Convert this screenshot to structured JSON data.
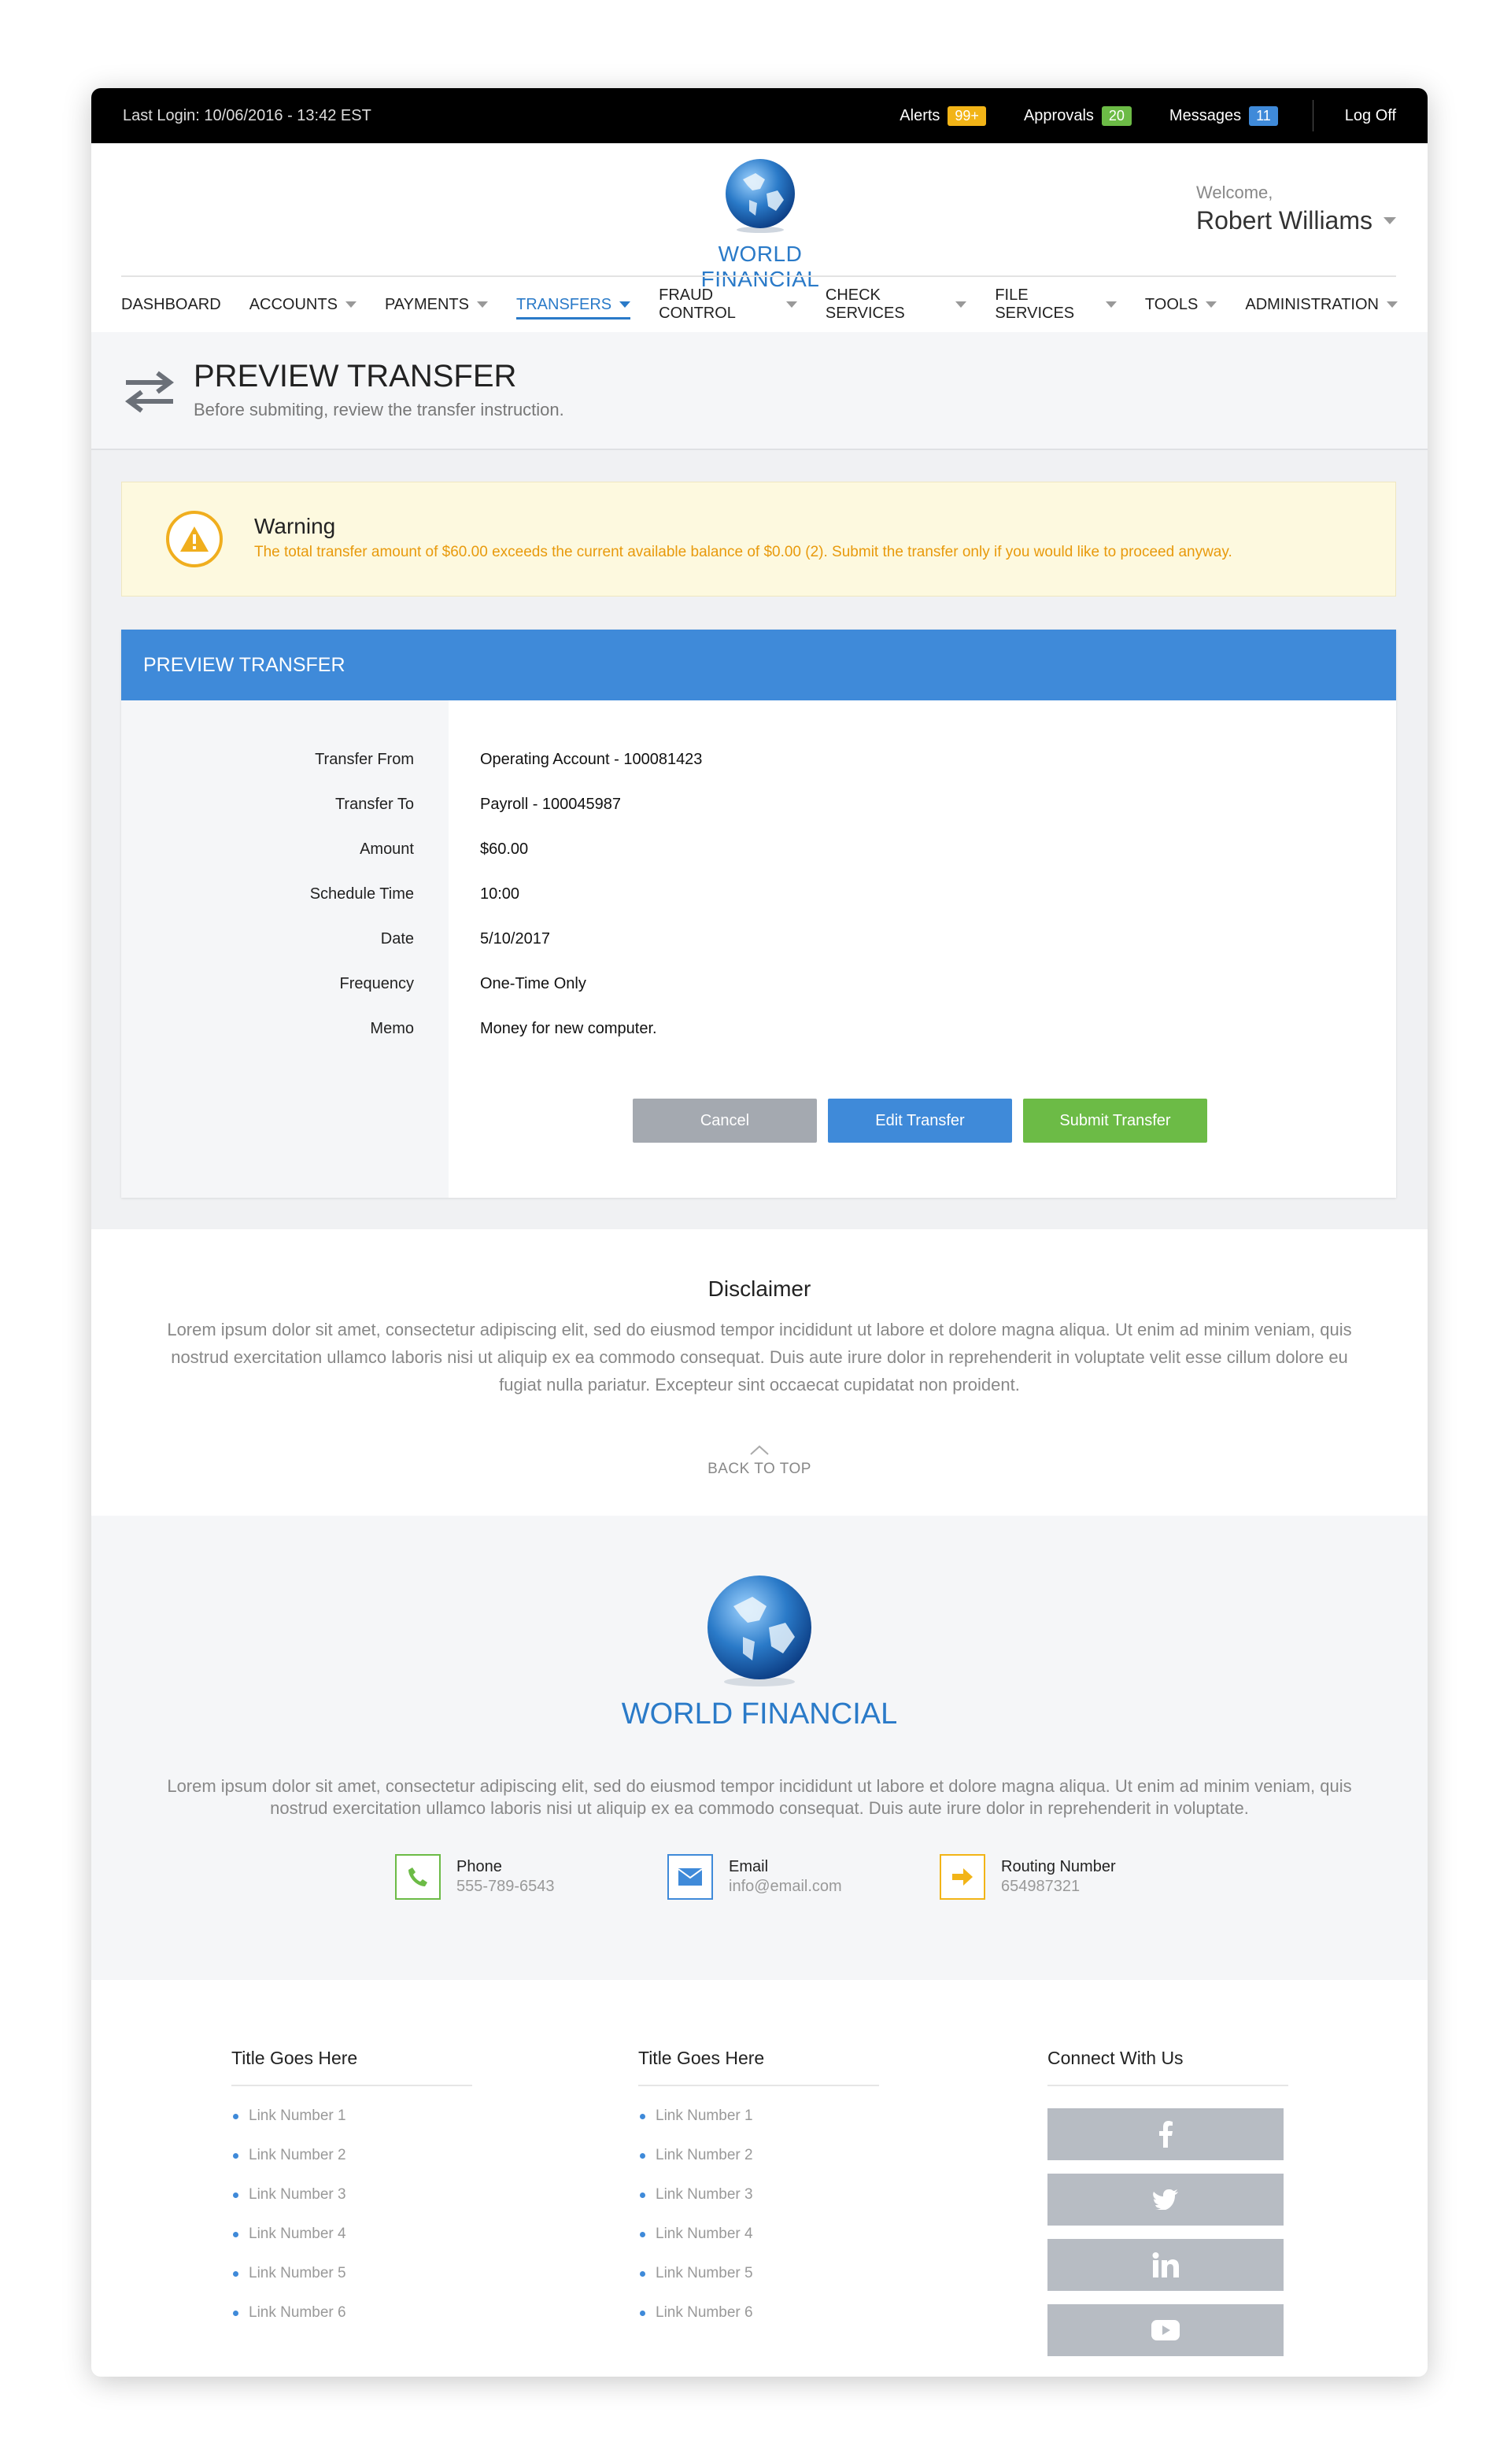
{
  "topbar": {
    "last_login": "Last Login: 10/06/2016 - 13:42 EST",
    "alerts_label": "Alerts",
    "alerts_count": "99+",
    "approvals_label": "Approvals",
    "approvals_count": "20",
    "messages_label": "Messages",
    "messages_count": "11",
    "logoff_label": "Log Off",
    "colors": {
      "alerts": "#f2b417",
      "approvals": "#6cbb46",
      "messages": "#3f8ad9"
    }
  },
  "brand": {
    "name": "WORLD FINANCIAL",
    "color": "#2a7ac8"
  },
  "user": {
    "welcome": "Welcome,",
    "name": "Robert Williams"
  },
  "nav": {
    "items": [
      {
        "label": "DASHBOARD",
        "dropdown": false
      },
      {
        "label": "ACCOUNTS",
        "dropdown": true
      },
      {
        "label": "PAYMENTS",
        "dropdown": true
      },
      {
        "label": "TRANSFERS",
        "dropdown": true,
        "active": true
      },
      {
        "label": "FRAUD CONTROL",
        "dropdown": true
      },
      {
        "label": "CHECK SERVICES",
        "dropdown": true
      },
      {
        "label": "FILE SERVICES",
        "dropdown": true
      },
      {
        "label": "TOOLS",
        "dropdown": true
      },
      {
        "label": "ADMINISTRATION",
        "dropdown": true
      }
    ]
  },
  "page": {
    "title": "PREVIEW TRANSFER",
    "subtitle": "Before submiting, review the transfer instruction.",
    "icon": "transfer-arrows-icon"
  },
  "warning": {
    "title": "Warning",
    "text": "The total transfer amount of $60.00 exceeds the current available balance of $0.00 (2). Submit the transfer only if you would like to proceed anyway.",
    "icon": "warning-triangle-icon",
    "color": "#e89a0c"
  },
  "preview": {
    "header": "PREVIEW TRANSFER",
    "fields": [
      {
        "label": "Transfer From",
        "value": "Operating Account - 100081423"
      },
      {
        "label": "Transfer To",
        "value": "Payroll - 100045987"
      },
      {
        "label": "Amount",
        "value": "$60.00"
      },
      {
        "label": "Schedule Time",
        "value": "10:00"
      },
      {
        "label": "Date",
        "value": "5/10/2017"
      },
      {
        "label": "Frequency",
        "value": "One-Time Only"
      },
      {
        "label": "Memo",
        "value": "Money for new computer."
      }
    ],
    "buttons": {
      "cancel": "Cancel",
      "edit": "Edit Transfer",
      "submit": "Submit Transfer"
    }
  },
  "disclaimer": {
    "title": "Disclaimer",
    "text": "Lorem ipsum dolor sit amet, consectetur adipiscing elit, sed do eiusmod tempor incididunt ut labore et dolore magna aliqua. Ut enim ad minim veniam, quis nostrud exercitation ullamco laboris nisi ut aliquip ex ea commodo consequat. Duis aute irure dolor in reprehenderit in voluptate velit esse cillum dolore eu fugiat nulla pariatur. Excepteur sint occaecat cupidatat non proident.",
    "back_to_top": "BACK TO TOP"
  },
  "footer_info": {
    "text": "Lorem ipsum dolor sit amet, consectetur adipiscing elit, sed do eiusmod tempor incididunt ut labore et dolore magna aliqua. Ut enim ad minim veniam, quis nostrud exercitation ullamco laboris nisi ut aliquip ex ea commodo consequat. Duis aute irure dolor in reprehenderit in voluptate.",
    "contacts": [
      {
        "title": "Phone",
        "value": "555-789-6543",
        "icon": "phone-icon",
        "color": "#6cbb46"
      },
      {
        "title": "Email",
        "value": "info@email.com",
        "icon": "envelope-icon",
        "color": "#3f8ad9"
      },
      {
        "title": "Routing Number",
        "value": "654987321",
        "icon": "arrow-right-icon",
        "color": "#f2b417"
      }
    ]
  },
  "footer_links": {
    "columns": [
      {
        "title": "Title Goes Here",
        "links": [
          "Link Number 1",
          "Link Number 2",
          "Link Number 3",
          "Link Number 4",
          "Link Number 5",
          "Link Number 6"
        ]
      },
      {
        "title": "Title Goes Here",
        "links": [
          "Link Number 1",
          "Link Number 2",
          "Link Number 3",
          "Link Number 4",
          "Link Number 5",
          "Link Number 6"
        ]
      }
    ],
    "connect_title": "Connect With Us",
    "social": [
      "facebook-icon",
      "twitter-icon",
      "linkedin-icon",
      "youtube-icon"
    ]
  }
}
